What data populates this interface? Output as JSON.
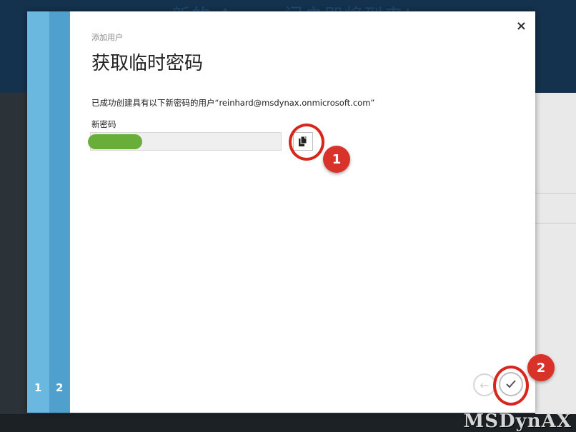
{
  "background": {
    "header_text": "新的 A...... 门户即将到来!"
  },
  "dialog": {
    "subtitle": "添加用户",
    "title": "获取临时密码",
    "info": "已成功创建具有以下新密码的用户“reinhard@msdynax.onmicrosoft.com”",
    "password_label": "新密码",
    "close_label": "×",
    "steps": [
      "1",
      "2"
    ]
  },
  "annotations": {
    "callout_1": "1",
    "callout_2": "2"
  },
  "watermark": {
    "text": "MSDynAX"
  },
  "icons": {
    "copy": "copy-icon",
    "back": "arrow-left-icon",
    "finish": "checkmark-icon",
    "close": "close-icon"
  },
  "colors": {
    "rail_1": "#6ab8e0",
    "rail_2": "#4fa0cc",
    "callout_red": "#d8261c",
    "password_redact": "#6aae3a"
  }
}
